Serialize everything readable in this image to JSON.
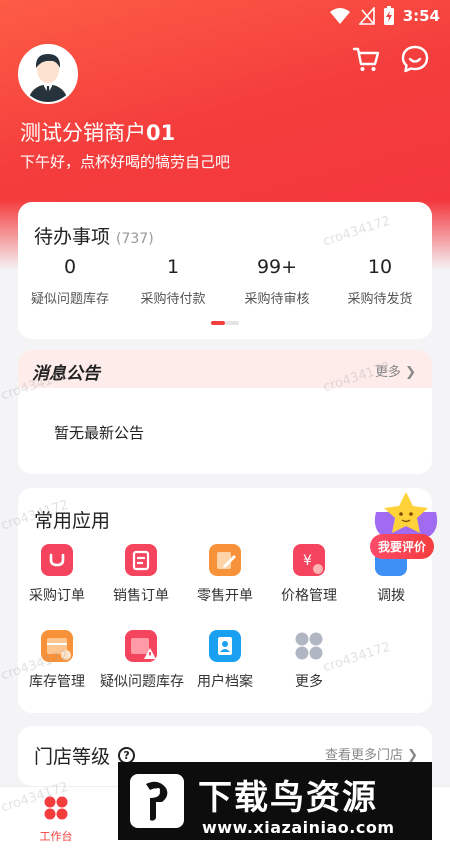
{
  "status_bar": {
    "time": "3:54"
  },
  "header": {
    "merchant_name": "测试分销商户",
    "merchant_suffix": "01",
    "greeting": "下午好，点杯好喝的犒劳自己吧",
    "cart_icon": "cart-icon",
    "message_icon": "chat-bubble-icon"
  },
  "todo": {
    "title": "待办事项",
    "count": "(737)",
    "stats": [
      {
        "value": "0",
        "label": "疑似问题库存"
      },
      {
        "value": "1",
        "label": "采购待付款"
      },
      {
        "value": "99+",
        "label": "采购待审核"
      },
      {
        "value": "10",
        "label": "采购待发货"
      }
    ]
  },
  "notice": {
    "title": "消息公告",
    "more": "更多 ❯",
    "empty": "暂无最新公告"
  },
  "apps": {
    "title": "常用应用",
    "items": [
      {
        "label": "采购订单",
        "icon": "purchase-order-icon",
        "color": "#f5455e"
      },
      {
        "label": "销售订单",
        "icon": "sales-order-icon",
        "color": "#f5455e"
      },
      {
        "label": "零售开单",
        "icon": "retail-order-icon",
        "color": "#f8923a"
      },
      {
        "label": "价格管理",
        "icon": "price-management-icon",
        "color": "#f5455e"
      },
      {
        "label": "调拨",
        "icon": "transfer-icon",
        "color": "#3e8ff6"
      },
      {
        "label": "库存管理",
        "icon": "inventory-icon",
        "color": "#f8923a"
      },
      {
        "label": "疑似问题库存",
        "icon": "problem-inventory-icon",
        "color": "#f5455e"
      },
      {
        "label": "用户档案",
        "icon": "user-profile-icon",
        "color": "#1aa0f0"
      },
      {
        "label": "更多",
        "icon": "more-apps-icon",
        "color": "#b0b6c2"
      }
    ]
  },
  "store": {
    "title": "门店等级",
    "more": "查看更多门店 ❯"
  },
  "review": {
    "label": "我要评价"
  },
  "tabbar": {
    "home_label": "工作台"
  },
  "banner": {
    "title": "下载鸟资源",
    "url": "www.xiazainiao.com"
  },
  "watermark": "cro434172",
  "colors": {
    "primary": "#f43d3d",
    "hero_start": "#fd5c45",
    "background": "#f4f4f6"
  }
}
